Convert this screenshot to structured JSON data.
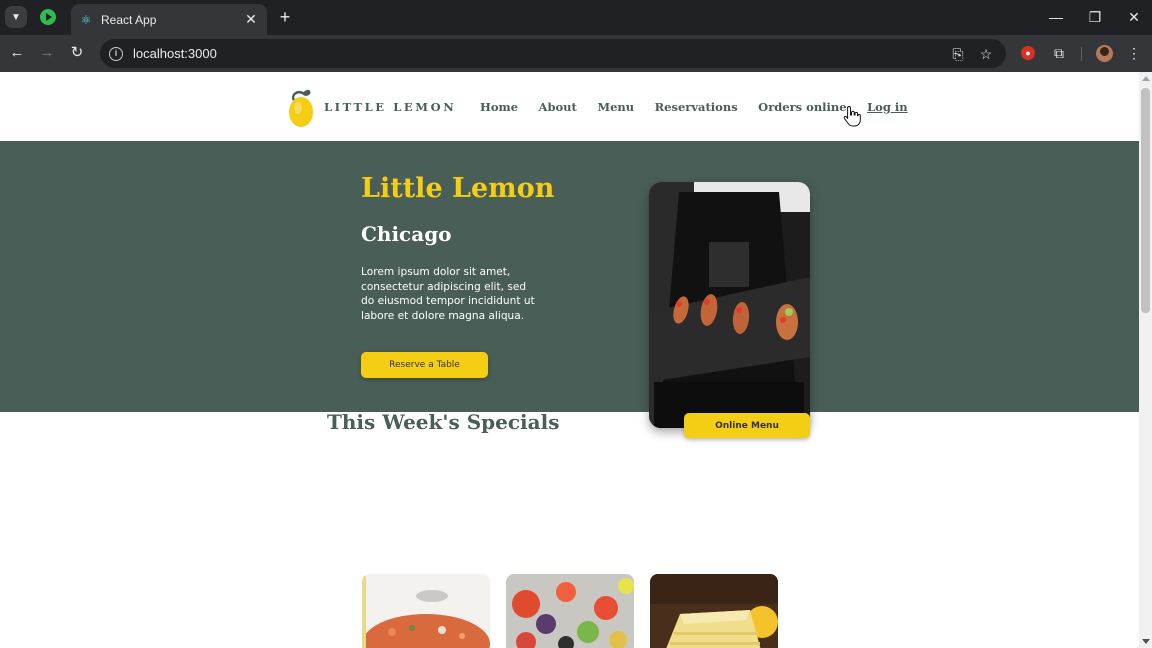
{
  "browser": {
    "tab_title": "React App",
    "url": "localhost:3000",
    "new_tab_symbol": "+",
    "tab_close_symbol": "✕"
  },
  "site": {
    "logo_text": "LITTLE LEMON",
    "nav": [
      "Home",
      "About",
      "Menu",
      "Reservations",
      "Orders online",
      "Log in"
    ]
  },
  "hero": {
    "title": "Little Lemon",
    "subtitle": "Chicago",
    "description": "Lorem ipsum dolor sit amet, consectetur adipiscing elit, sed do eiusmod tempor incididunt ut labore et dolore magna aliqua.",
    "reserve_button": "Reserve a Table"
  },
  "specials": {
    "title": "This Week's Specials",
    "online_menu_button": "Online Menu"
  },
  "colors": {
    "primary_green": "#495e57",
    "primary_yellow": "#f4ce14",
    "browser_dark": "#202124"
  }
}
